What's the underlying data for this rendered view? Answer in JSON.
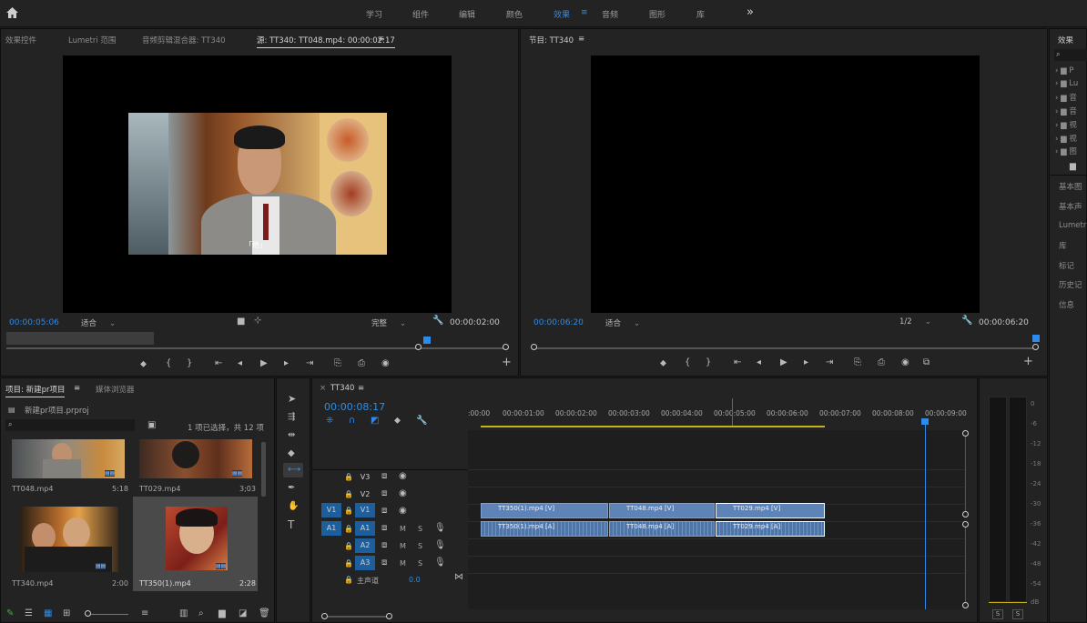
{
  "workspaces": [
    "学习",
    "组件",
    "编辑",
    "颜色",
    "效果",
    "音频",
    "图形",
    "库"
  ],
  "active_workspace": "效果",
  "more_glyph": "»",
  "source": {
    "tabs": [
      "效果控件",
      "Lumetri 范围",
      "音频剪辑混合器: TT340",
      "源: TT340: TT048.mp4: 00:00:02:17"
    ],
    "menu_glyph": "≡",
    "timecode": "00:00:05:06",
    "fit": "适合",
    "quality": "完整",
    "duration": "00:00:02:00",
    "subtitle": "「绝」"
  },
  "program": {
    "tab": "节目: TT340",
    "menu_glyph": "≡",
    "timecode": "00:00:06:20",
    "fit": "适合",
    "quality": "1/2",
    "duration": "00:00:06:20"
  },
  "effects": {
    "title": "效果",
    "folders": [
      "P",
      "Lu",
      "音",
      "音",
      "视",
      "视",
      "图"
    ],
    "collapsed": [
      "基本图",
      "基本声",
      "Lumetri",
      "库",
      "标记",
      "历史记",
      "信息"
    ]
  },
  "project": {
    "tab": "项目: 新建pr项目",
    "tab2": "媒体浏览器",
    "file": "新建pr项目.prproj",
    "status": "1 项已选择，共 12 项",
    "items": [
      {
        "name": "TT048.mp4",
        "duration": ""
      },
      {
        "name": "TT029.mp4",
        "duration": "3;03"
      },
      {
        "name": "TT340.mp4",
        "duration": "2:00"
      },
      {
        "name": "TT350(1).mp4",
        "duration": "2:28"
      }
    ],
    "item0_dur": "5:18"
  },
  "timeline": {
    "tab": "TT340",
    "menu_glyph": "≡",
    "timecode": "00:00:08:17",
    "ruler": [
      ":00:00",
      "00:00:01:00",
      "00:00:02:00",
      "00:00:03:00",
      "00:00:04:00",
      "00:00:05:00",
      "00:00:06:00",
      "00:00:07:00",
      "00:00:08:00",
      "00:00:09:00"
    ],
    "tracks": {
      "v3": "V3",
      "v2": "V2",
      "v1": "V1",
      "a1": "A1",
      "a2": "A2",
      "a3": "A3",
      "m": "M",
      "s": "S",
      "master": "主声道",
      "master_val": "0.0"
    },
    "clips_v": [
      "TT350(1).mp4 [V]",
      "TT048.mp4 [V]",
      "TT029.mp4 [V]"
    ],
    "clips_a": [
      "TT350(1).mp4 [A]",
      "TT048.mp4 [A]",
      "TT029.mp4 [A]"
    ]
  },
  "meter": {
    "ticks": [
      "0",
      "-6",
      "-12",
      "-18",
      "-24",
      "-30",
      "-36",
      "-42",
      "-48",
      "-54",
      "dB"
    ],
    "solo": "S"
  },
  "colors": {
    "accent": "#2d8ceb",
    "clip_video": "#5d83b7",
    "clip_audio": "#4f74a6",
    "workarea": "#c7b21a"
  }
}
